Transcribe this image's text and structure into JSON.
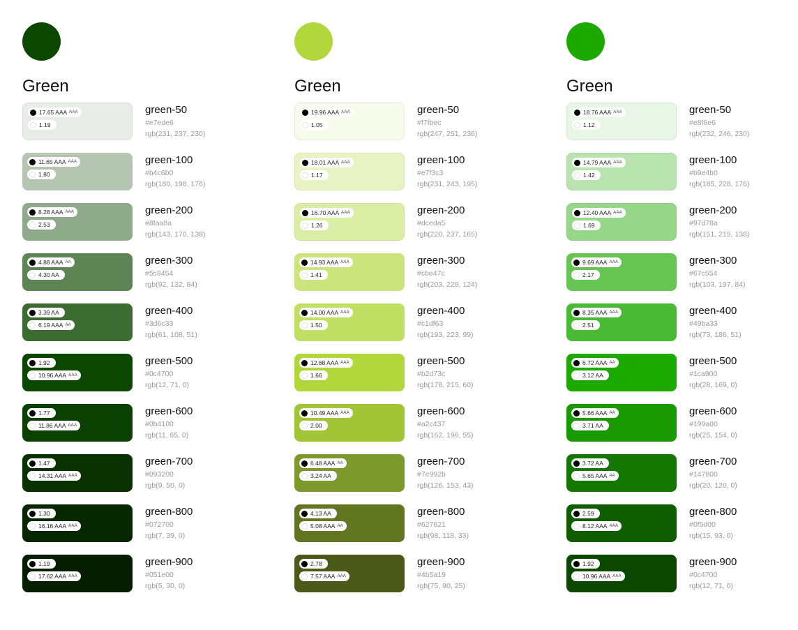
{
  "palettes": [
    {
      "title": "Green",
      "color": "#0c4700",
      "shades": [
        {
          "name": "green-50",
          "hex": "#e7ede6",
          "rgb": "rgb(231, 237, 230)",
          "black_ratio": "17.65 AAA",
          "black_level": "AAA",
          "white_ratio": "1.19",
          "white_level": ""
        },
        {
          "name": "green-100",
          "hex": "#b4c6b0",
          "rgb": "rgb(180, 198, 176)",
          "black_ratio": "11.65 AAA",
          "black_level": "AAA",
          "white_ratio": "1.80",
          "white_level": ""
        },
        {
          "name": "green-200",
          "hex": "#8faa8a",
          "rgb": "rgb(143, 170, 138)",
          "black_ratio": "8.28 AAA",
          "black_level": "AAA",
          "white_ratio": "2.53",
          "white_level": ""
        },
        {
          "name": "green-300",
          "hex": "#5c8454",
          "rgb": "rgb(92, 132, 84)",
          "black_ratio": "4.88 AAA",
          "black_level": "AA",
          "white_ratio": "4.30 AA",
          "white_level": ""
        },
        {
          "name": "green-400",
          "hex": "#3d6c33",
          "rgb": "rgb(61, 108, 51)",
          "black_ratio": "3.39 AA",
          "black_level": "",
          "white_ratio": "6.19 AAA",
          "white_level": "AA"
        },
        {
          "name": "green-500",
          "hex": "#0c4700",
          "rgb": "rgb(12, 71, 0)",
          "black_ratio": "1.92",
          "black_level": "",
          "white_ratio": "10.96 AAA",
          "white_level": "AAA"
        },
        {
          "name": "green-600",
          "hex": "#0b4100",
          "rgb": "rgb(11, 65, 0)",
          "black_ratio": "1.77",
          "black_level": "",
          "white_ratio": "11.86 AAA",
          "white_level": "AAA"
        },
        {
          "name": "green-700",
          "hex": "#093200",
          "rgb": "rgb(9, 50, 0)",
          "black_ratio": "1.47",
          "black_level": "",
          "white_ratio": "14.31 AAA",
          "white_level": "AAA"
        },
        {
          "name": "green-800",
          "hex": "#072700",
          "rgb": "rgb(7, 39, 0)",
          "black_ratio": "1.30",
          "black_level": "",
          "white_ratio": "16.16 AAA",
          "white_level": "AAA"
        },
        {
          "name": "green-900",
          "hex": "#051e00",
          "rgb": "rgb(5, 30, 0)",
          "black_ratio": "1.19",
          "black_level": "",
          "white_ratio": "17.62 AAA",
          "white_level": "AAA"
        }
      ]
    },
    {
      "title": "Green",
      "color": "#b2d73c",
      "shades": [
        {
          "name": "green-50",
          "hex": "#f7fbec",
          "rgb": "rgb(247, 251, 236)",
          "black_ratio": "19.96 AAA",
          "black_level": "AAA",
          "white_ratio": "1.05",
          "white_level": ""
        },
        {
          "name": "green-100",
          "hex": "#e7f3c3",
          "rgb": "rgb(231, 243, 195)",
          "black_ratio": "18.01 AAA",
          "black_level": "AAA",
          "white_ratio": "1.17",
          "white_level": ""
        },
        {
          "name": "green-200",
          "hex": "#dceda5",
          "rgb": "rgb(220, 237, 165)",
          "black_ratio": "16.70 AAA",
          "black_level": "AAA",
          "white_ratio": "1.26",
          "white_level": ""
        },
        {
          "name": "green-300",
          "hex": "#cbe47c",
          "rgb": "rgb(203, 228, 124)",
          "black_ratio": "14.93 AAA",
          "black_level": "AAA",
          "white_ratio": "1.41",
          "white_level": ""
        },
        {
          "name": "green-400",
          "hex": "#c1df63",
          "rgb": "rgb(193, 223, 99)",
          "black_ratio": "14.00 AAA",
          "black_level": "AAA",
          "white_ratio": "1.50",
          "white_level": ""
        },
        {
          "name": "green-500",
          "hex": "#b2d73c",
          "rgb": "rgb(178, 215, 60)",
          "black_ratio": "12.68 AAA",
          "black_level": "AAA",
          "white_ratio": "1.66",
          "white_level": ""
        },
        {
          "name": "green-600",
          "hex": "#a2c437",
          "rgb": "rgb(162, 196, 55)",
          "black_ratio": "10.49 AAA",
          "black_level": "AAA",
          "white_ratio": "2.00",
          "white_level": ""
        },
        {
          "name": "green-700",
          "hex": "#7e992b",
          "rgb": "rgb(126, 153, 43)",
          "black_ratio": "6.48 AAA",
          "black_level": "AA",
          "white_ratio": "3.24 AA",
          "white_level": ""
        },
        {
          "name": "green-800",
          "hex": "#627621",
          "rgb": "rgb(98, 118, 33)",
          "black_ratio": "4.13 AA",
          "black_level": "",
          "white_ratio": "5.08 AAA",
          "white_level": "AA"
        },
        {
          "name": "green-900",
          "hex": "#4b5a19",
          "rgb": "rgb(75, 90, 25)",
          "black_ratio": "2.78",
          "black_level": "",
          "white_ratio": "7.57 AAA",
          "white_level": "AAA"
        }
      ]
    },
    {
      "title": "Green",
      "color": "#1ca900",
      "shades": [
        {
          "name": "green-50",
          "hex": "#e8f6e6",
          "rgb": "rgb(232, 246, 230)",
          "black_ratio": "18.76 AAA",
          "black_level": "AAA",
          "white_ratio": "1.12",
          "white_level": ""
        },
        {
          "name": "green-100",
          "hex": "#b9e4b0",
          "rgb": "rgb(185, 228, 176)",
          "black_ratio": "14.79 AAA",
          "black_level": "AAA",
          "white_ratio": "1.42",
          "white_level": ""
        },
        {
          "name": "green-200",
          "hex": "#97d78a",
          "rgb": "rgb(151, 215, 138)",
          "black_ratio": "12.40 AAA",
          "black_level": "AAA",
          "white_ratio": "1.69",
          "white_level": ""
        },
        {
          "name": "green-300",
          "hex": "#67c554",
          "rgb": "rgb(103, 197, 84)",
          "black_ratio": "9.69 AAA",
          "black_level": "AAA",
          "white_ratio": "2.17",
          "white_level": ""
        },
        {
          "name": "green-400",
          "hex": "#49ba33",
          "rgb": "rgb(73, 186, 51)",
          "black_ratio": "8.35 AAA",
          "black_level": "AAA",
          "white_ratio": "2.51",
          "white_level": ""
        },
        {
          "name": "green-500",
          "hex": "#1ca900",
          "rgb": "rgb(28, 169, 0)",
          "black_ratio": "6.72 AAA",
          "black_level": "AA",
          "white_ratio": "3.12 AA",
          "white_level": ""
        },
        {
          "name": "green-600",
          "hex": "#199a00",
          "rgb": "rgb(25, 154, 0)",
          "black_ratio": "5.66 AAA",
          "black_level": "AA",
          "white_ratio": "3.71 AA",
          "white_level": ""
        },
        {
          "name": "green-700",
          "hex": "#147800",
          "rgb": "rgb(20, 120, 0)",
          "black_ratio": "3.72 AA",
          "black_level": "",
          "white_ratio": "5.65 AAA",
          "white_level": "AA"
        },
        {
          "name": "green-800",
          "hex": "#0f5d00",
          "rgb": "rgb(15, 93, 0)",
          "black_ratio": "2.59",
          "black_level": "",
          "white_ratio": "8.12 AAA",
          "white_level": "AAA"
        },
        {
          "name": "green-900",
          "hex": "#0c4700",
          "rgb": "rgb(12, 71, 0)",
          "black_ratio": "1.92",
          "black_level": "",
          "white_ratio": "10.96 AAA",
          "white_level": "AAA"
        }
      ]
    }
  ]
}
